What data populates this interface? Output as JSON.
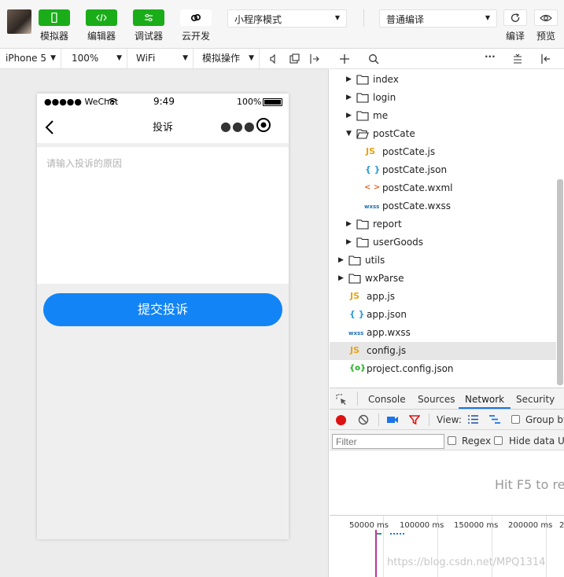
{
  "toolbar": {
    "simulator_label": "模拟器",
    "editor_label": "编辑器",
    "debugger_label": "调试器",
    "cloud_label": "云开发",
    "mode_select": "小程序模式",
    "compile_select": "普通编译",
    "compile_label": "编译",
    "preview_label": "预览",
    "accent_color": "#1aad19"
  },
  "simbar": {
    "device": "iPhone 5",
    "zoom": "100%",
    "network": "WiFi",
    "operation": "模拟操作"
  },
  "phone": {
    "carrier": "●●●●● WeChat",
    "time": "9:49",
    "battery": "100%",
    "nav_title": "投诉",
    "placeholder": "请输入投诉的原因",
    "submit_label": "提交投诉",
    "submit_color": "#1284f6"
  },
  "tree": {
    "items": [
      {
        "name": "index",
        "icon": "folder-icon"
      },
      {
        "name": "login",
        "icon": "folder-icon"
      },
      {
        "name": "me",
        "icon": "folder-icon"
      },
      {
        "name": "postCate",
        "icon": "folder-open-icon"
      },
      {
        "name": "postCate.js",
        "icon": "js-file-icon"
      },
      {
        "name": "postCate.json",
        "icon": "json-file-icon"
      },
      {
        "name": "postCate.wxml",
        "icon": "wxml-file-icon"
      },
      {
        "name": "postCate.wxss",
        "icon": "wxss-file-icon"
      },
      {
        "name": "report",
        "icon": "folder-icon"
      },
      {
        "name": "userGoods",
        "icon": "folder-icon"
      },
      {
        "name": "utils",
        "icon": "folder-icon"
      },
      {
        "name": "wxParse",
        "icon": "folder-icon"
      },
      {
        "name": "app.js",
        "icon": "js-file-icon"
      },
      {
        "name": "app.json",
        "icon": "json-file-icon"
      },
      {
        "name": "app.wxss",
        "icon": "wxss-file-icon"
      },
      {
        "name": "config.js",
        "icon": "js-file-icon"
      },
      {
        "name": "project.config.json",
        "icon": "config-file-icon"
      }
    ],
    "selected": "config.js"
  },
  "devtools": {
    "tabs": [
      "Console",
      "Sources",
      "Network",
      "Security"
    ],
    "active_tab": "Network",
    "view_label": "View:",
    "group_label": "Group by",
    "filter_placeholder": "Filter",
    "regex_label": "Regex",
    "hide_label": "Hide data UR",
    "hint": "Hit F5 to re",
    "ticks": [
      "50000 ms",
      "100000 ms",
      "150000 ms",
      "200000 ms",
      "2"
    ]
  },
  "watermark": "https://blog.csdn.net/MPQ1314"
}
